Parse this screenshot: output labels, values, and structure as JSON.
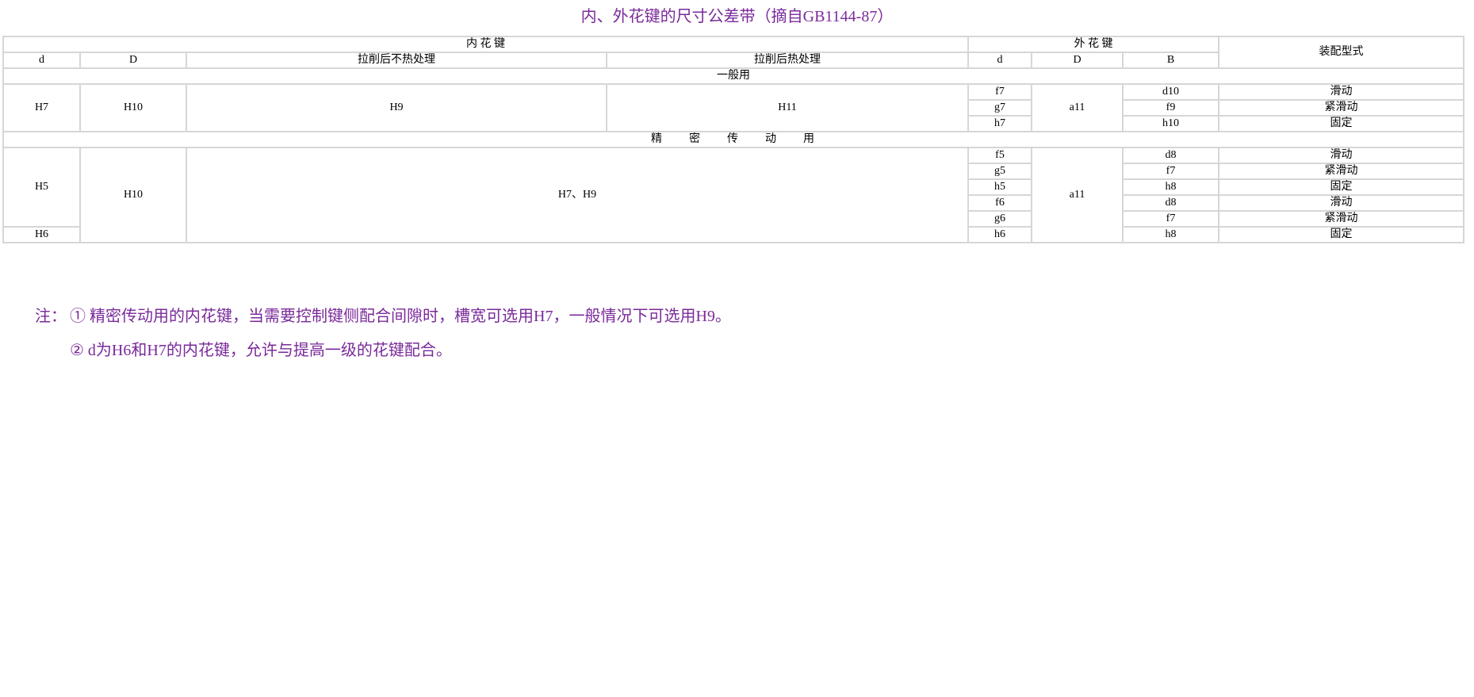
{
  "title": "内、外花键的尺寸公差带（摘自GB1144-87）",
  "colors": {
    "accent_purple": "#7a2a9a",
    "grid_border": "#d6d6d6"
  },
  "table": {
    "header": {
      "inner_spline": "内 花 键",
      "outer_spline": "外 花 键",
      "fit_type": "装配型式",
      "inner_d": "d",
      "inner_D": "D",
      "no_heat": "拉削后不热处理",
      "heat": "拉削后热处理",
      "outer_d": "d",
      "outer_D": "D",
      "outer_B": "B"
    },
    "general": {
      "section_label": "一般用",
      "inner_d": "H7",
      "inner_D": "H10",
      "no_heat": "H9",
      "heat": "H11",
      "outer_D": "a11",
      "rows": [
        {
          "d": "f7",
          "B": "d10",
          "fit": "滑动"
        },
        {
          "d": "g7",
          "B": "f9",
          "fit": "紧滑动"
        },
        {
          "d": "h7",
          "B": "h10",
          "fit": "固定"
        }
      ]
    },
    "precision": {
      "section_label": "精　　密　　传　　动　　用",
      "inner_d_main": "H5",
      "inner_d_last": "H6",
      "inner_D": "H10",
      "B_tolerance": "H7、H9",
      "outer_D": "a11",
      "rows": [
        {
          "d": "f5",
          "B": "d8",
          "fit": "滑动"
        },
        {
          "d": "g5",
          "B": "f7",
          "fit": "紧滑动"
        },
        {
          "d": "h5",
          "B": "h8",
          "fit": "固定"
        },
        {
          "d": "f6",
          "B": "d8",
          "fit": "滑动"
        },
        {
          "d": "g6",
          "B": "f7",
          "fit": "紧滑动"
        },
        {
          "d": "h6",
          "B": "h8",
          "fit": "固定"
        }
      ]
    }
  },
  "notes": {
    "prefix": "注：",
    "note1": "① 精密传动用的内花键，当需要控制键侧配合间隙时，槽宽可选用H7，一般情况下可选用H9。",
    "note2": "② d为H6和H7的内花键，允许与提高一级的花键配合。"
  }
}
